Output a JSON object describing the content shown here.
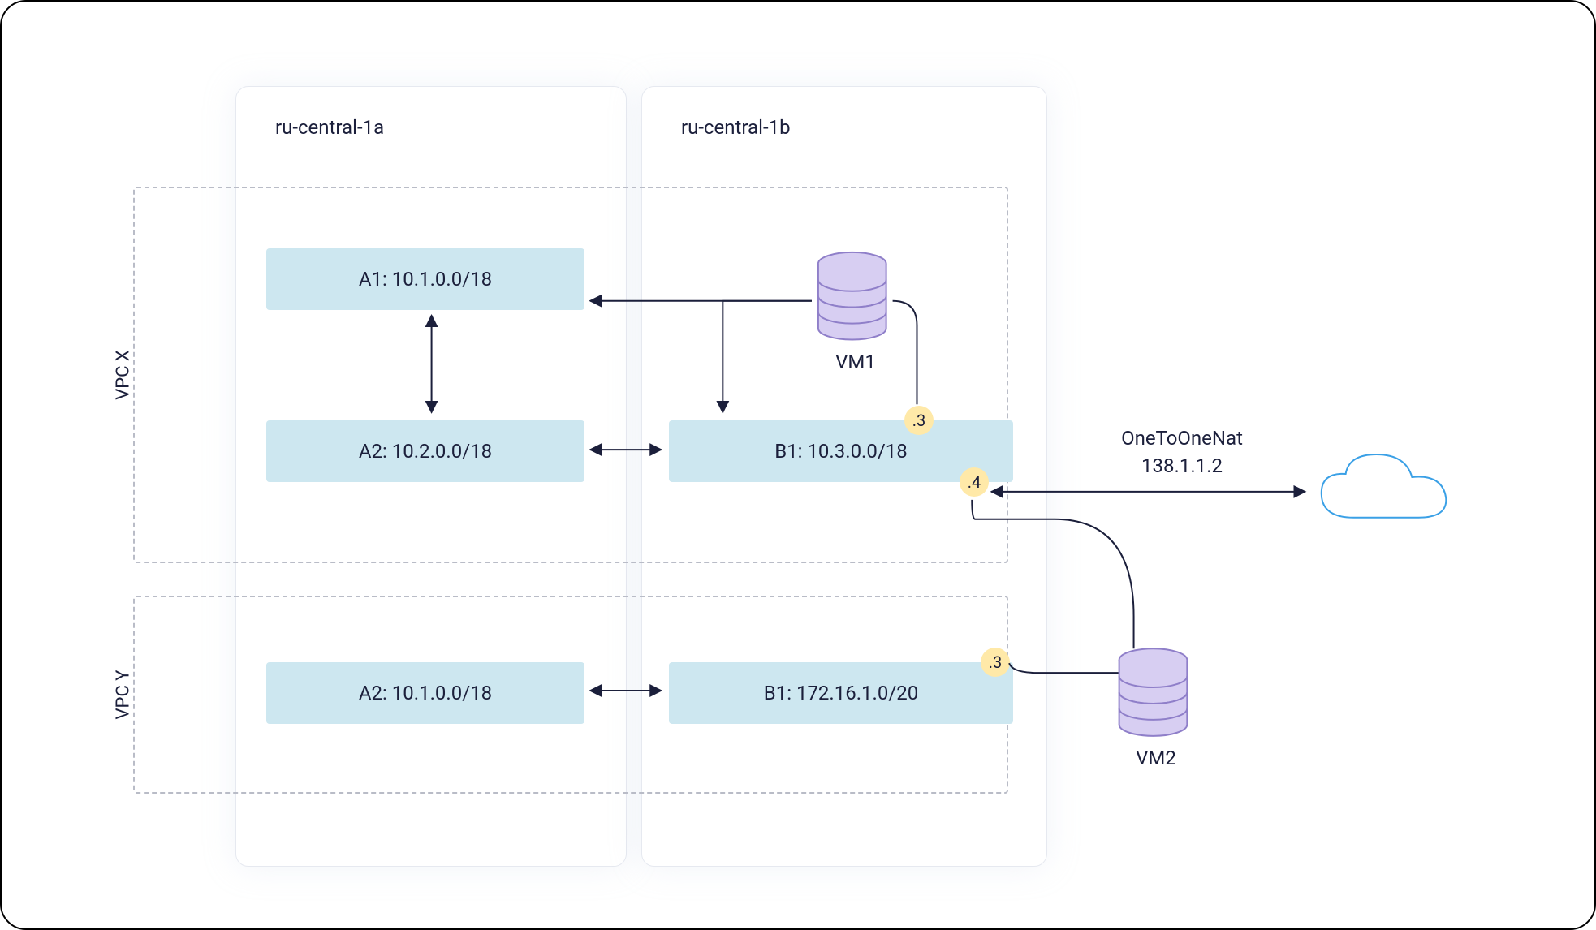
{
  "zones": {
    "a": {
      "label": "ru-central-1a"
    },
    "b": {
      "label": "ru-central-1b"
    }
  },
  "vpcs": {
    "x": {
      "label": "VPC X"
    },
    "y": {
      "label": "VPC Y"
    }
  },
  "subnets": {
    "x_a1": "A1: 10.1.0.0/18",
    "x_a2": "A2: 10.2.0.0/18",
    "x_b1": "B1: 10.3.0.0/18",
    "y_a2": "A2: 10.1.0.0/18",
    "y_b1": "B1: 172.16.1.0/20"
  },
  "vms": {
    "vm1": "VM1",
    "vm2": "VM2"
  },
  "nat": {
    "title": "OneToOneNat",
    "ip": "138.1.1.2"
  },
  "badges": {
    "b1_top": ".3",
    "b1_bottom": ".4",
    "y_b1": ".3"
  }
}
